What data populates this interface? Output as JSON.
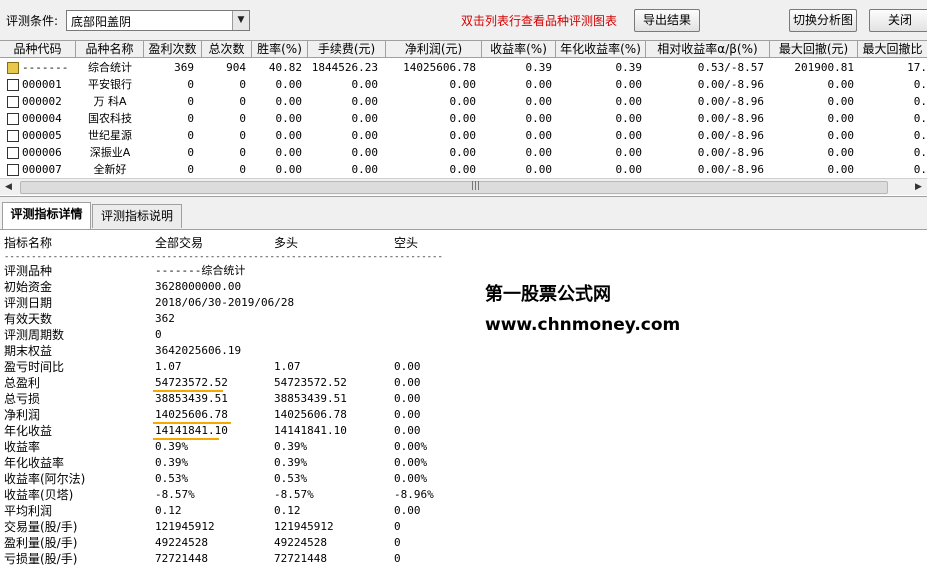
{
  "toolbar": {
    "condition_label": "评测条件:",
    "condition_value": "底部阳盖阴",
    "hint": "双击列表行查看品种评测图表",
    "export_label": "导出结果",
    "switch_label": "切换分析图",
    "close_label": "关闭"
  },
  "grid": {
    "columns": [
      "品种代码",
      "品种名称",
      "盈利次数",
      "总次数",
      "胜率(%)",
      "手续费(元)",
      "净利润(元)",
      "收益率(%)",
      "年化收益率(%)",
      "相对收益率α/β(%)",
      "最大回撤(元)",
      "最大回撤比"
    ],
    "rows": [
      [
        "-------",
        "综合统计",
        "369",
        "904",
        "40.82",
        "1844526.23",
        "14025606.78",
        "0.39",
        "0.39",
        "0.53/-8.57",
        "201900.81",
        "17."
      ],
      [
        "000001",
        "平安银行",
        "0",
        "0",
        "0.00",
        "0.00",
        "0.00",
        "0.00",
        "0.00",
        "0.00/-8.96",
        "0.00",
        "0."
      ],
      [
        "000002",
        "万 科A",
        "0",
        "0",
        "0.00",
        "0.00",
        "0.00",
        "0.00",
        "0.00",
        "0.00/-8.96",
        "0.00",
        "0."
      ],
      [
        "000004",
        "国农科技",
        "0",
        "0",
        "0.00",
        "0.00",
        "0.00",
        "0.00",
        "0.00",
        "0.00/-8.96",
        "0.00",
        "0."
      ],
      [
        "000005",
        "世纪星源",
        "0",
        "0",
        "0.00",
        "0.00",
        "0.00",
        "0.00",
        "0.00",
        "0.00/-8.96",
        "0.00",
        "0."
      ],
      [
        "000006",
        "深振业A",
        "0",
        "0",
        "0.00",
        "0.00",
        "0.00",
        "0.00",
        "0.00",
        "0.00/-8.96",
        "0.00",
        "0."
      ],
      [
        "000007",
        "全新好",
        "0",
        "0",
        "0.00",
        "0.00",
        "0.00",
        "0.00",
        "0.00",
        "0.00/-8.96",
        "0.00",
        "0."
      ]
    ]
  },
  "tabs": [
    {
      "label": "评测指标详情"
    },
    {
      "label": "评测指标说明"
    }
  ],
  "details": {
    "headers": [
      "指标名称",
      "全部交易",
      "多头",
      "空头"
    ],
    "dashes": "------------------------------------------------------------------------------------",
    "rows": [
      [
        "评测品种",
        "-------综合统计",
        "",
        ""
      ],
      [
        "初始资金",
        "3628000000.00",
        "",
        ""
      ],
      [
        "评测日期",
        "2018/06/30-2019/06/28",
        "",
        ""
      ],
      [
        "有效天数",
        "362",
        "",
        ""
      ],
      [
        "评测周期数",
        "0",
        "",
        ""
      ],
      [
        "期末权益",
        "3642025606.19",
        "",
        ""
      ],
      [
        "盈亏时间比",
        "1.07",
        "1.07",
        "0.00"
      ],
      [
        "总盈利",
        "54723572.52",
        "54723572.52",
        "0.00"
      ],
      [
        "总亏损",
        "38853439.51",
        "38853439.51",
        "0.00"
      ],
      [
        "净利润",
        "14025606.78",
        "14025606.78",
        "0.00"
      ],
      [
        "年化收益",
        "14141841.10",
        "14141841.10",
        "0.00"
      ],
      [
        "收益率",
        "0.39%",
        "0.39%",
        "0.00%"
      ],
      [
        "年化收益率",
        "0.39%",
        "0.39%",
        "0.00%"
      ],
      [
        "收益率(阿尔法)",
        "0.53%",
        "0.53%",
        "0.00%"
      ],
      [
        "收益率(贝塔)",
        "-8.57%",
        "-8.57%",
        "-8.96%"
      ],
      [
        "平均利润",
        "0.12",
        "0.12",
        "0.00"
      ],
      [
        "交易量(股/手)",
        "121945912",
        "121945912",
        "0"
      ],
      [
        "盈利量(股/手)",
        "49224528",
        "49224528",
        "0"
      ],
      [
        "亏损量(股/手)",
        "72721448",
        "72721448",
        "0"
      ]
    ]
  },
  "watermark": {
    "line1": "第一股票公式网",
    "line2": "www.chnmoney.com"
  },
  "colors": {
    "hint": "#d40000",
    "underline": "#f5a800"
  }
}
